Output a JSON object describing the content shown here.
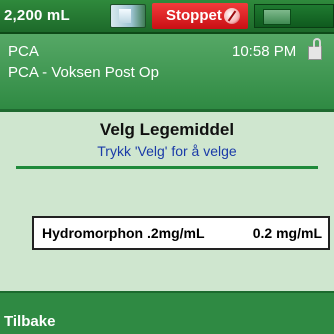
{
  "status_bar": {
    "volume": "2,200 mL",
    "state_label": "Stoppet",
    "state_color": "#d8141a",
    "battery_icon": "battery-icon",
    "stopped_icon": "stopped-icon",
    "pump_icon": "pump-icon"
  },
  "header": {
    "title": "PCA",
    "time": "10:58 PM",
    "subtitle": "PCA - Voksen Post Op",
    "lock_icon": "lock-icon"
  },
  "main": {
    "title": "Velg Legemiddel",
    "instruction": "Trykk 'Velg' for å velge",
    "items": [
      {
        "name": "Hydromorphon .2mg/mL",
        "concentration": "0.2 mg/mL"
      }
    ]
  },
  "footer": {
    "back_label": "Tilbake"
  },
  "colors": {
    "accent_green": "#2f8a43",
    "background": "#cfe6cf",
    "instruction_blue": "#1a3aa8"
  }
}
